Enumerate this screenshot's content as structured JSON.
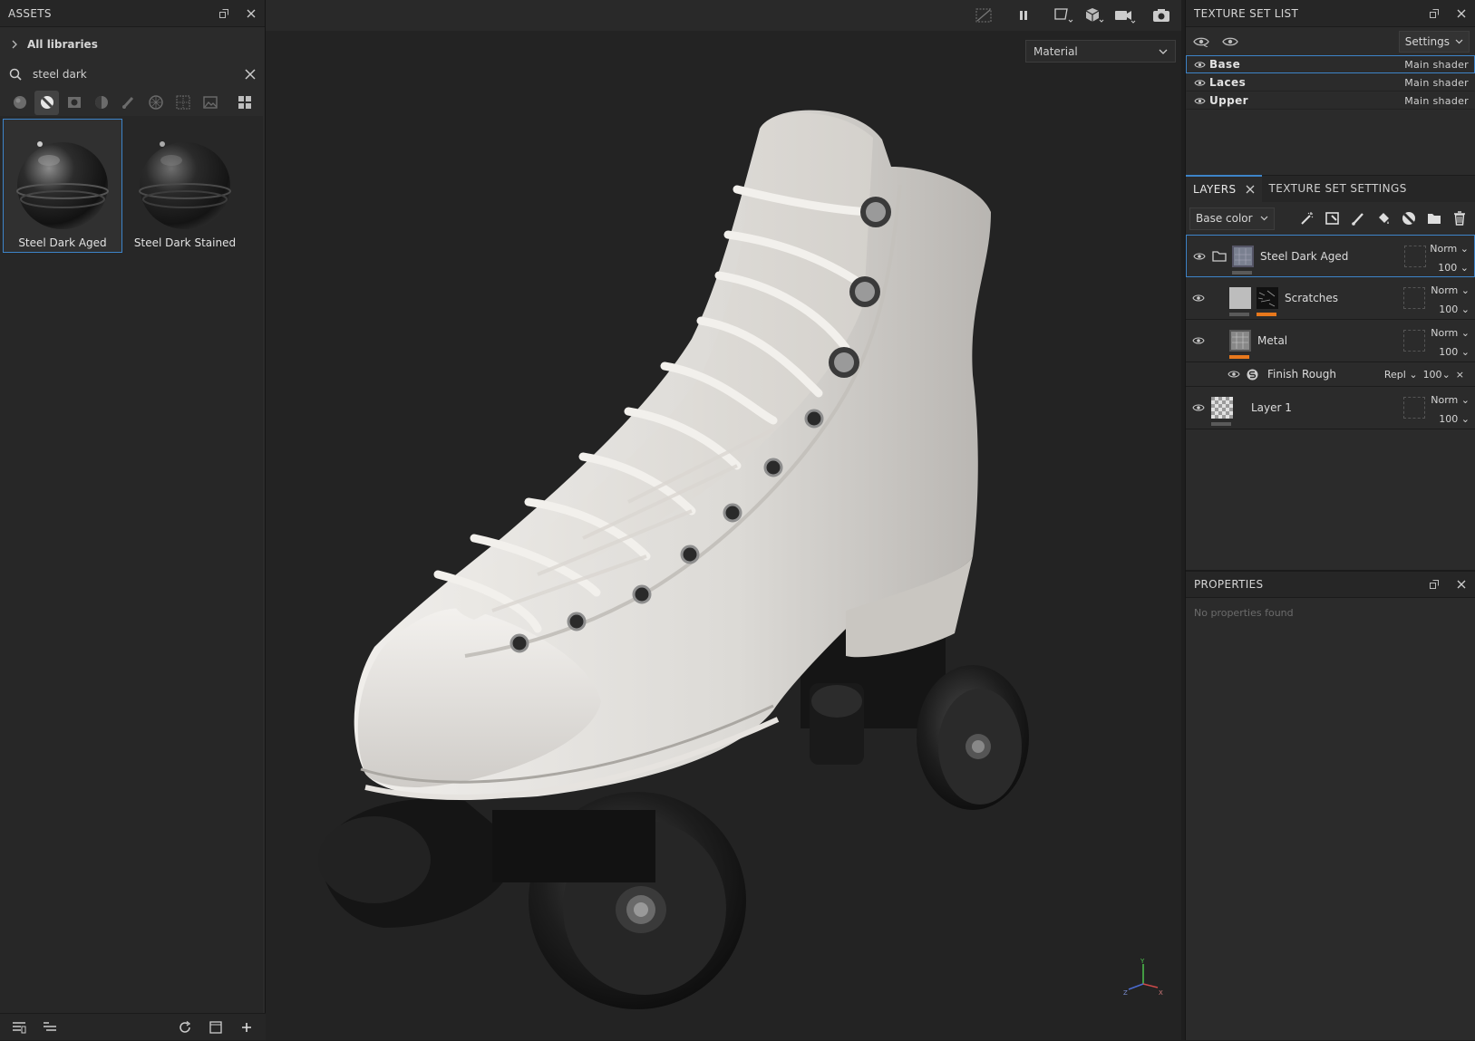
{
  "assets": {
    "title": "ASSETS",
    "library": "All libraries",
    "search_value": "steel dark",
    "filters": [
      "material-icon",
      "smart-material-icon",
      "mask-icon",
      "smart-mask-icon",
      "brush-icon",
      "texture-icon",
      "alpha-icon",
      "environment-icon",
      "grid-view-icon"
    ],
    "items": [
      {
        "name": "Steel Dark Aged",
        "selected": true
      },
      {
        "name": "Steel Dark Stained",
        "selected": false
      }
    ]
  },
  "viewport": {
    "mode_select": "Material",
    "gizmo": {
      "y": "Y",
      "z": "Z",
      "x": "X"
    }
  },
  "texture_set_list": {
    "title": "TEXTURE SET LIST",
    "settings_label": "Settings",
    "sets": [
      {
        "name": "Base",
        "shader": "Main shader",
        "selected": true
      },
      {
        "name": "Laces",
        "shader": "Main shader",
        "selected": false
      },
      {
        "name": "Upper",
        "shader": "Main shader",
        "selected": false
      }
    ]
  },
  "layers": {
    "tab_layers": "LAYERS",
    "tab_settings": "TEXTURE SET SETTINGS",
    "channel": "Base color",
    "rows": [
      {
        "name": "Steel Dark Aged",
        "blend": "Norm",
        "opacity": "100"
      },
      {
        "name": "Scratches",
        "blend": "Norm",
        "opacity": "100"
      },
      {
        "name": "Metal",
        "blend": "Norm",
        "opacity": "100"
      },
      {
        "name": "Finish Rough",
        "blend": "Repl",
        "opacity": "100"
      },
      {
        "name": "Layer 1",
        "blend": "Norm",
        "opacity": "100"
      }
    ]
  },
  "properties": {
    "title": "PROPERTIES",
    "empty_text": "No properties found"
  },
  "colors": {
    "accent": "#3d84c9",
    "mask_bar": "#e8781c",
    "panel_bg": "#2b2b2b",
    "viewport_bg": "#232323"
  }
}
